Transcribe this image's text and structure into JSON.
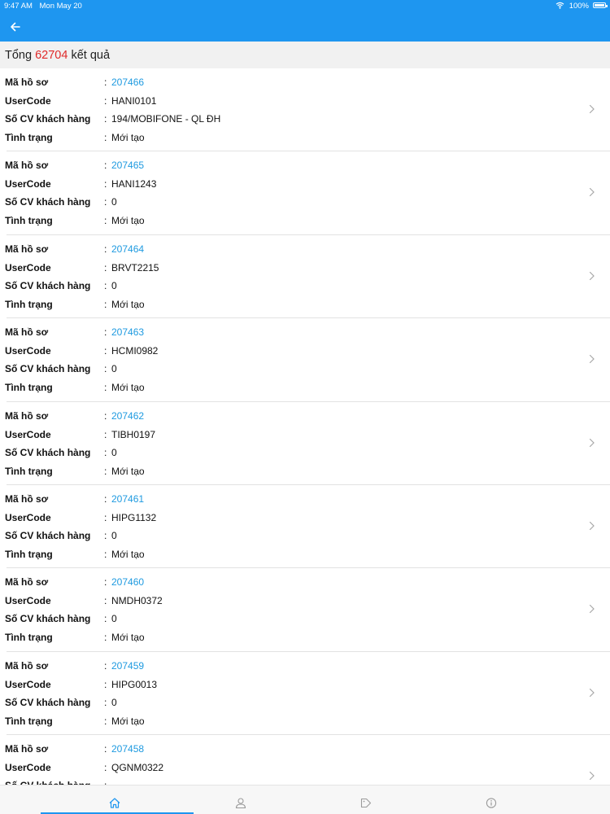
{
  "status_bar": {
    "time": "9:47 AM",
    "date": "Mon May 20",
    "battery": "100%"
  },
  "summary": {
    "prefix": "Tổng",
    "count": "62704",
    "suffix": "kết quả"
  },
  "labels": {
    "ma_ho_so": "Mã hồ sơ",
    "user_code": "UserCode",
    "so_cv": "Số CV khách hàng",
    "tinh_trang": "Tình trạng"
  },
  "items": [
    {
      "ma_ho_so": "207466",
      "user_code": "HANI0101",
      "so_cv": "194/MOBIFONE - QL ĐH",
      "tinh_trang": "Mới tạo"
    },
    {
      "ma_ho_so": "207465",
      "user_code": "HANI1243",
      "so_cv": "0",
      "tinh_trang": "Mới tạo"
    },
    {
      "ma_ho_so": "207464",
      "user_code": "BRVT2215",
      "so_cv": "0",
      "tinh_trang": "Mới tạo"
    },
    {
      "ma_ho_so": "207463",
      "user_code": "HCMI0982",
      "so_cv": "0",
      "tinh_trang": "Mới tạo"
    },
    {
      "ma_ho_so": "207462",
      "user_code": "TIBH0197",
      "so_cv": "0",
      "tinh_trang": "Mới tạo"
    },
    {
      "ma_ho_so": "207461",
      "user_code": "HIPG1132",
      "so_cv": "0",
      "tinh_trang": "Mới tạo"
    },
    {
      "ma_ho_so": "207460",
      "user_code": "NMDH0372",
      "so_cv": "0",
      "tinh_trang": "Mới tạo"
    },
    {
      "ma_ho_so": "207459",
      "user_code": "HIPG0013",
      "so_cv": "0",
      "tinh_trang": "Mới tạo"
    },
    {
      "ma_ho_so": "207458",
      "user_code": "QGNM0322",
      "so_cv": "",
      "tinh_trang": ""
    }
  ],
  "tabs": [
    {
      "icon": "home-icon",
      "active": true
    },
    {
      "icon": "user-icon",
      "active": false
    },
    {
      "icon": "tag-icon",
      "active": false
    },
    {
      "icon": "info-icon",
      "active": false
    }
  ],
  "colors": {
    "primary": "#1e96f0",
    "link": "#1e9ae0",
    "count": "#e02a2a"
  }
}
